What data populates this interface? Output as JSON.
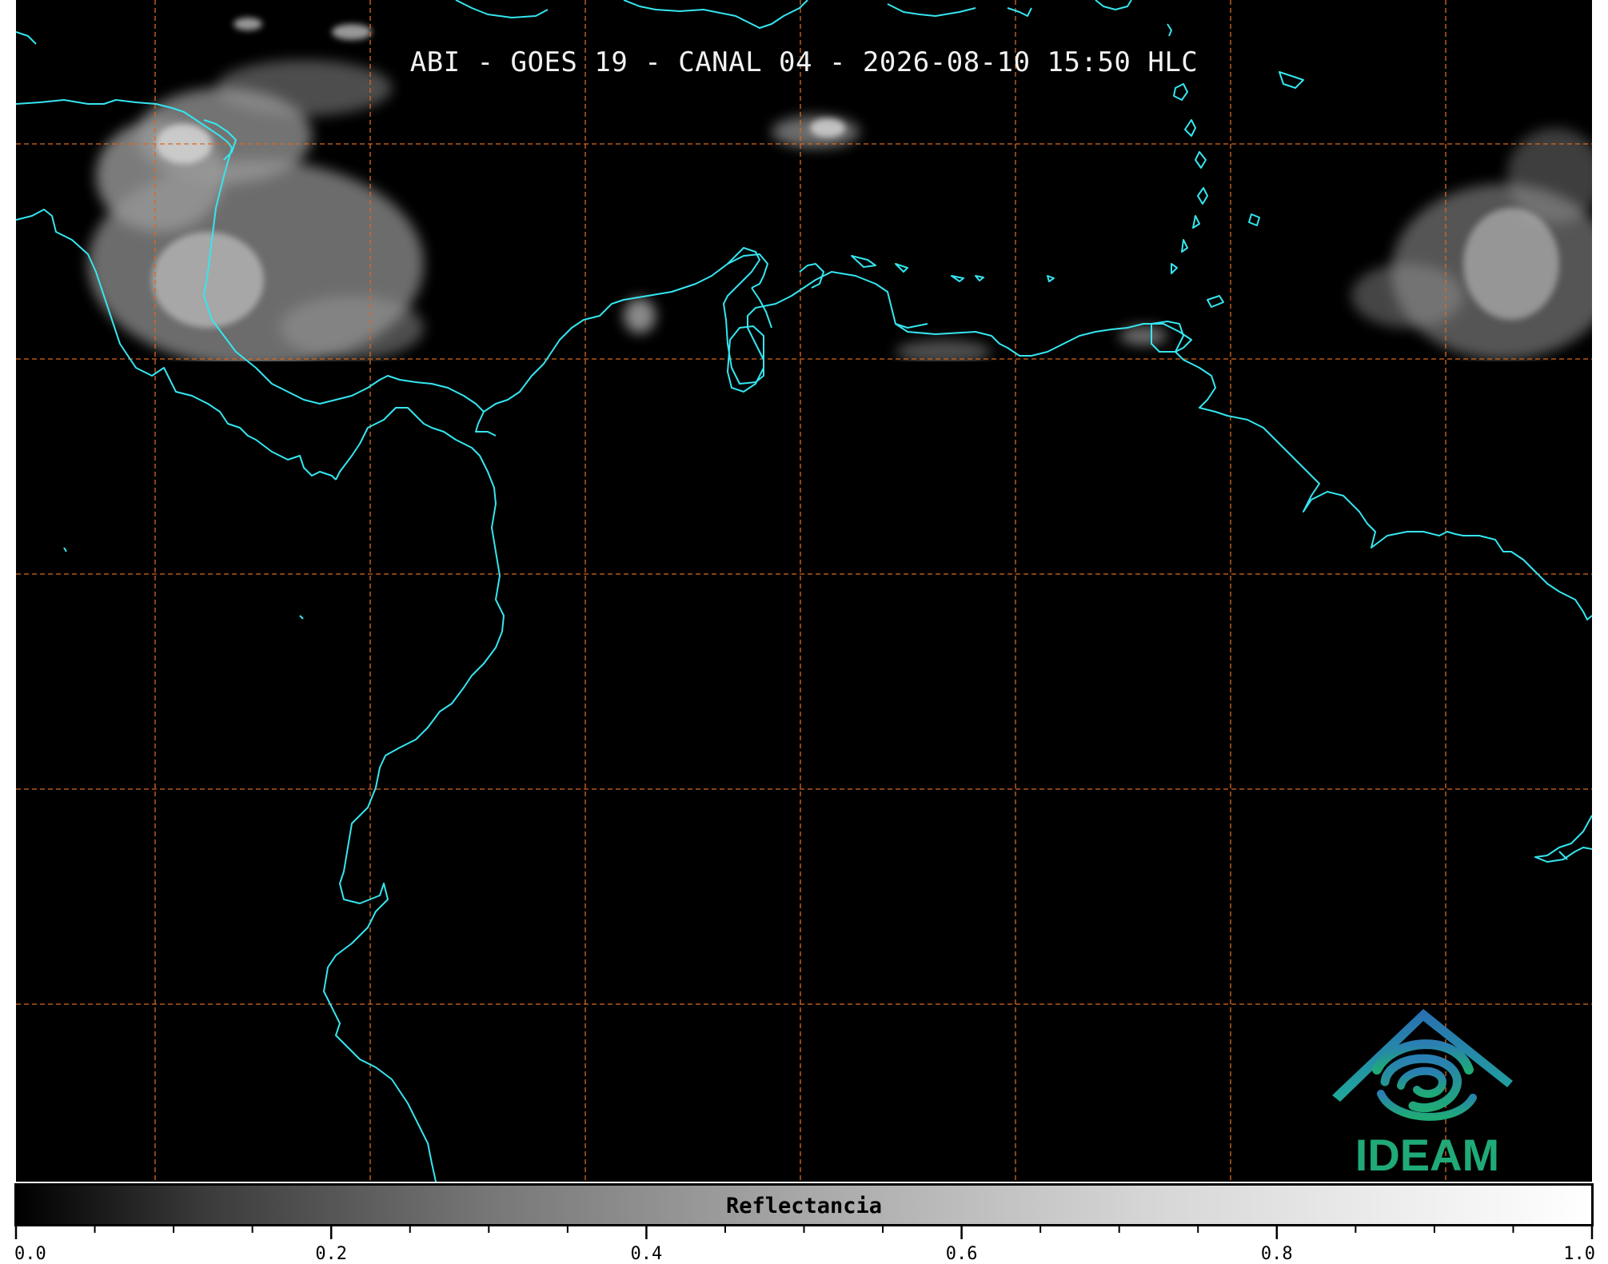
{
  "map": {
    "title": "ABI - GOES 19 - CANAL 04 - 2026-08-10 15:50 HLC",
    "colors": {
      "background": "#000000",
      "coastline": "#35e6f0",
      "grid": "#d9691f",
      "logo_blue": "#2a6fb3",
      "logo_green": "#1faa77"
    }
  },
  "logo": {
    "text": "IDEAM"
  },
  "colorbar": {
    "label": "Reflectancia",
    "range": [
      0.0,
      1.0
    ],
    "tick_labels": [
      "0.0",
      "0.2",
      "0.4",
      "0.6",
      "0.8",
      "1.0"
    ]
  }
}
